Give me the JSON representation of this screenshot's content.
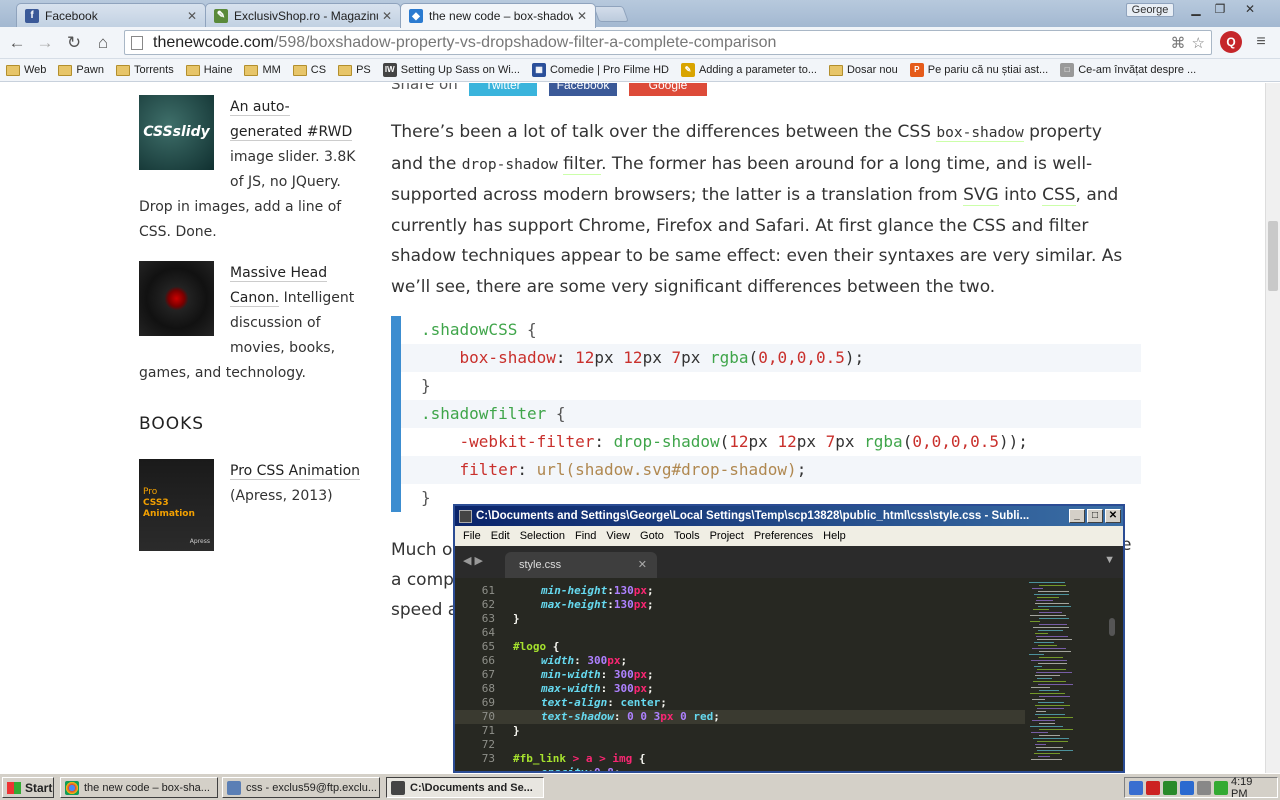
{
  "browser": {
    "tabs": [
      {
        "label": "Facebook",
        "icon": "facebook-icon",
        "color": "#3b5998"
      },
      {
        "label": "ExclusivShop.ro - Magazinul t",
        "icon": "shop-icon",
        "color": "#5a8a3a"
      },
      {
        "label": "the new code – box-shadow",
        "icon": "newcode-icon",
        "color": "#2a7ad0"
      }
    ],
    "user": "George",
    "url_host": "thenewcode.com",
    "url_path": "/598/boxshadow-property-vs-dropshadow-filter-a-complete-comparison",
    "bookmarks": [
      {
        "label": "Web",
        "type": "folder"
      },
      {
        "label": "Pawn",
        "type": "folder"
      },
      {
        "label": "Torrents",
        "type": "folder"
      },
      {
        "label": "Haine",
        "type": "folder"
      },
      {
        "label": "MM",
        "type": "folder"
      },
      {
        "label": "CS",
        "type": "folder"
      },
      {
        "label": "PS",
        "type": "folder"
      },
      {
        "label": "Setting Up Sass on Wi...",
        "type": "link",
        "icon": "IW",
        "color": "#444"
      },
      {
        "label": "Comedie | Pro Filme HD",
        "type": "link",
        "icon": "▦",
        "color": "#2a4f9a"
      },
      {
        "label": "Adding a parameter to...",
        "type": "link",
        "icon": "✎",
        "color": "#d9a400"
      },
      {
        "label": "Dosar nou",
        "type": "folder"
      },
      {
        "label": "Pe pariu că nu știai ast...",
        "type": "link",
        "icon": "P",
        "color": "#e55b1a"
      },
      {
        "label": "Ce-am învățat despre ...",
        "type": "link",
        "icon": "□",
        "color": "#999"
      }
    ]
  },
  "sidebar": {
    "items": [
      {
        "title": "An auto-generated #RWD",
        "desc": "image slider. 3.8K of JS, no JQuery. Drop in images, add a line of CSS. Done.",
        "thumb_text": "CSSslidy"
      },
      {
        "title": "Massive Head Canon.",
        "desc": "Intelligent discussion of movies, books, games, and technology.",
        "thumb_text": ""
      }
    ],
    "books_heading": "BOOKS",
    "book": {
      "title": "Pro CSS Animation",
      "desc": "(Apress, 2013)",
      "cover_line1": "Pro",
      "cover_line2": "CSS3 Animation",
      "publisher": "Apress"
    }
  },
  "share": {
    "label": "Share on",
    "buttons": [
      {
        "label": "Twitter",
        "color": "#3ab4dc"
      },
      {
        "label": "Facebook",
        "color": "#3b5998"
      },
      {
        "label": "Google",
        "color": "#dd4b39"
      }
    ]
  },
  "article": {
    "p1_a": "There’s been a lot of talk over the differences between the CSS ",
    "p1_code1": "box-shadow",
    "p1_b": " property and the ",
    "p1_code2": "drop-shadow",
    "p1_c": " ",
    "p1_link1": "filter",
    "p1_d": ". The former has been around for a long time, and is well-supported across modern browsers; the latter is a translation from ",
    "p1_link2": "SVG",
    "p1_e": " into ",
    "p1_link3": "CSS",
    "p1_f": ", and currently has support Chrome, Firefox and Safari.  At first glance the CSS and filter shadow techniques appear to be same effect: even their syntaxes are very similar. As we’ll see, there are some very significant differences between the two.",
    "after_lines": [
      "Much o",
      "a comp",
      "speed a"
    ],
    "after_right": "e"
  },
  "code": {
    "l1_sel": ".shadowCSS",
    "l2_prop": "box-shadow",
    "l2_val_a": "12",
    "l2_val_b": "12",
    "l2_val_c": "7",
    "l2_fn": "rgba",
    "l2_args": "0,0,0,0.5",
    "l4_sel": ".shadowfilter",
    "l5_prop": "-webkit-filter",
    "l5_fn": "drop-shadow",
    "l6_prop": "filter",
    "l6_val": "url(shadow.svg#drop-shadow)"
  },
  "sublime": {
    "title": "C:\\Documents and Settings\\George\\Local Settings\\Temp\\scp13828\\public_html\\css\\style.css - Subli...",
    "menu": [
      "File",
      "Edit",
      "Selection",
      "Find",
      "View",
      "Goto",
      "Tools",
      "Project",
      "Preferences",
      "Help"
    ],
    "tab": "style.css",
    "line_numbers": [
      "61",
      "62",
      "63",
      "64",
      "65",
      "66",
      "67",
      "68",
      "69",
      "70",
      "71",
      "72",
      "73"
    ]
  },
  "taskbar": {
    "start": "Start",
    "tasks": [
      {
        "label": "the new code – box-sha..."
      },
      {
        "label": "css - exclus59@ftp.exclu..."
      },
      {
        "label": "C:\\Documents and Se..."
      }
    ],
    "clock": "4:19 PM"
  }
}
